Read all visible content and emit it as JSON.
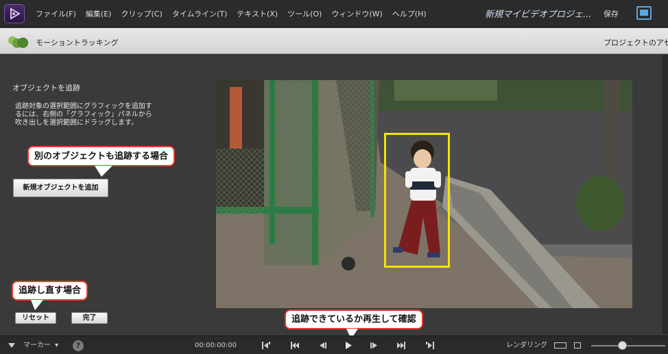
{
  "menubar": {
    "items": [
      "ファイル(F)",
      "編集(E)",
      "クリップ(C)",
      "タイムライン(T)",
      "テキスト(X)",
      "ツール(O)",
      "ウィンドウ(W)",
      "ヘルプ(H)"
    ],
    "project_title": "新規マイビデオプロジェ...",
    "save_label": "保存"
  },
  "panel": {
    "title": "モーショントラッキング",
    "assets_label": "プロジェクトのアセッ"
  },
  "sidebar": {
    "heading": "オブジェクトを追跡",
    "instructions": "追跡対象の選択範囲にグラフィックを追加するには、右側の「グラフィック」パネルから吹き出しを選択範囲にドラッグします。",
    "add_object_label": "新規オブジェクトを追加",
    "reset_label": "リセット",
    "done_label": "完了"
  },
  "callouts": {
    "another_object": "別のオブジェクトも追跡する場合",
    "retrack": "追跡し直す場合",
    "playback_check": "追跡できているか再生して確認"
  },
  "viewer": {
    "tracking_box_color": "#f5e400"
  },
  "transport": {
    "marker_label": "マーカー",
    "timecode": "00:00:00:00",
    "render_label": "レンダリング"
  }
}
